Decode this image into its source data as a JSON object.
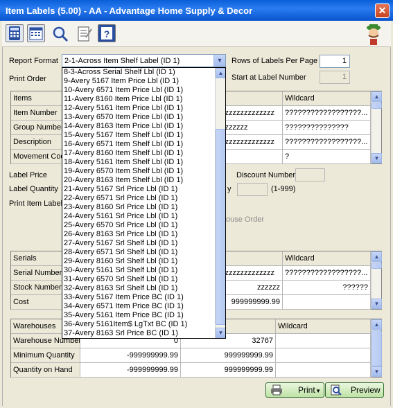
{
  "window": {
    "title": "Item Labels (5.00) - AA - Advantage Home Supply & Decor",
    "close_glyph": "✕"
  },
  "toolbar": {
    "icons": [
      "calculator-icon",
      "calendar-icon",
      "magnifier-icon",
      "checklist-icon",
      "help-icon",
      "mascot-icon"
    ]
  },
  "report_format": {
    "label": "Report Format",
    "value": "2-1-Across Item Shelf Label (ID 1)",
    "options": [
      "8-3-Across Serial Shelf Lbl (ID 1)",
      "9-Avery 5167 Item Price Lbl (ID 1)",
      "10-Avery 6571 Item Price Lbl (ID 1)",
      "11-Avery 8160 Item Price Lbl (ID 1)",
      "12-Avery 5161 Item Price Lbl (ID 1)",
      "13-Avery 6570 Item Price Lbl (ID 1)",
      "14-Avery 8163 Item Price Lbl (ID 1)",
      "15-Avery 5167 Item Shelf Lbl (ID 1)",
      "16-Avery 6571 Item Shelf Lbl (ID 1)",
      "17-Avery 8160 Item Shelf Lbl (ID 1)",
      "18-Avery 5161 Item Shelf Lbl (ID 1)",
      "19-Avery 6570 Item Shelf Lbl (ID 1)",
      "20-Avery 8163 Item Shelf Lbl (ID 1)",
      "21-Avery 5167 Srl Price Lbl (ID 1)",
      "22-Avery 6571 Srl Price Lbl (ID 1)",
      "23-Avery 8160 Srl Price Lbl (ID 1)",
      "24-Avery 5161 Srl Price Lbl (ID 1)",
      "25-Avery 6570 Srl Price Lbl (ID 1)",
      "26-Avery 8163 Srl Price Lbl (ID 1)",
      "27-Avery 5167 Srl Shelf Lbl (ID 1)",
      "28-Avery 6571 Srl Shelf Lbl (ID 1)",
      "29-Avery 8160 Srl Shelf Lbl (ID 1)",
      "30-Avery 5161 Srl Shelf Lbl (ID 1)",
      "31-Avery 6570 Srl Shelf Lbl (ID 1)",
      "32-Avery 8163 Srl Shelf Lbl (ID 1)",
      "33-Avery 5167 Item Price BC (ID 1)",
      "34-Avery 6571 Item Price BC (ID 1)",
      "35-Avery 5161 Item Price BC (ID 1)",
      "36-Avery 5161Item$ LgTxt BC (ID 1)",
      "37-Avery 8163 Srl Price BC (ID 1)"
    ]
  },
  "print_order": {
    "label": "Print Order"
  },
  "rows_per_page": {
    "label": "Rows of Labels Per Page",
    "value": "1"
  },
  "start_at": {
    "label": "Start at Label Number",
    "value": "1"
  },
  "items_grid": {
    "headers": [
      "Items",
      "Wildcard"
    ],
    "rows": [
      {
        "label": "Item Number",
        "to": "zzzzzzzzzzzzzz",
        "wildcard": "??????????????????..."
      },
      {
        "label": "Group Number",
        "to": "zzzzzzz",
        "wildcard": "???????????????"
      },
      {
        "label": "Description",
        "to": "zzzzzzzzzzzzzz",
        "wildcard": "??????????????????..."
      },
      {
        "label": "Movement Cod",
        "to": "",
        "wildcard": "?"
      }
    ]
  },
  "label_price": {
    "label": "Label Price"
  },
  "discount_number": {
    "label": "Discount Number"
  },
  "label_quantity": {
    "label": "Label Quantity",
    "fragment": "y",
    "range": "(1-999)"
  },
  "print_item_label": {
    "label": "Print Item Label"
  },
  "house_order": {
    "fragment": "ouse Order"
  },
  "serials_grid": {
    "headers": [
      "Serials",
      "Wildcard"
    ],
    "rows": [
      {
        "label": "Serial Number",
        "to": "zzzzzzzzzzzzzz",
        "wildcard": "??????????????????..."
      },
      {
        "label": "Stock Number",
        "to": "zzzzzz",
        "wildcard": "??????"
      },
      {
        "label": "Cost",
        "to": "999999999.99",
        "wildcard": ""
      }
    ]
  },
  "warehouses_grid": {
    "headers": [
      "Warehouses",
      "Wildcard"
    ],
    "rows": [
      {
        "label": "Warehouse Number",
        "from": "0",
        "to": "32767"
      },
      {
        "label": "Minimum Quantity",
        "from": "-999999999.99",
        "to": "999999999.99"
      },
      {
        "label": "Quantity on Hand",
        "from": "-999999999.99",
        "to": "999999999.99"
      }
    ]
  },
  "buttons": {
    "print": "Print",
    "preview": "Preview"
  },
  "colors": {
    "titlebar": "#0a5fd8",
    "button_green": "#bfe3a6",
    "close_red": "#c8441f"
  }
}
